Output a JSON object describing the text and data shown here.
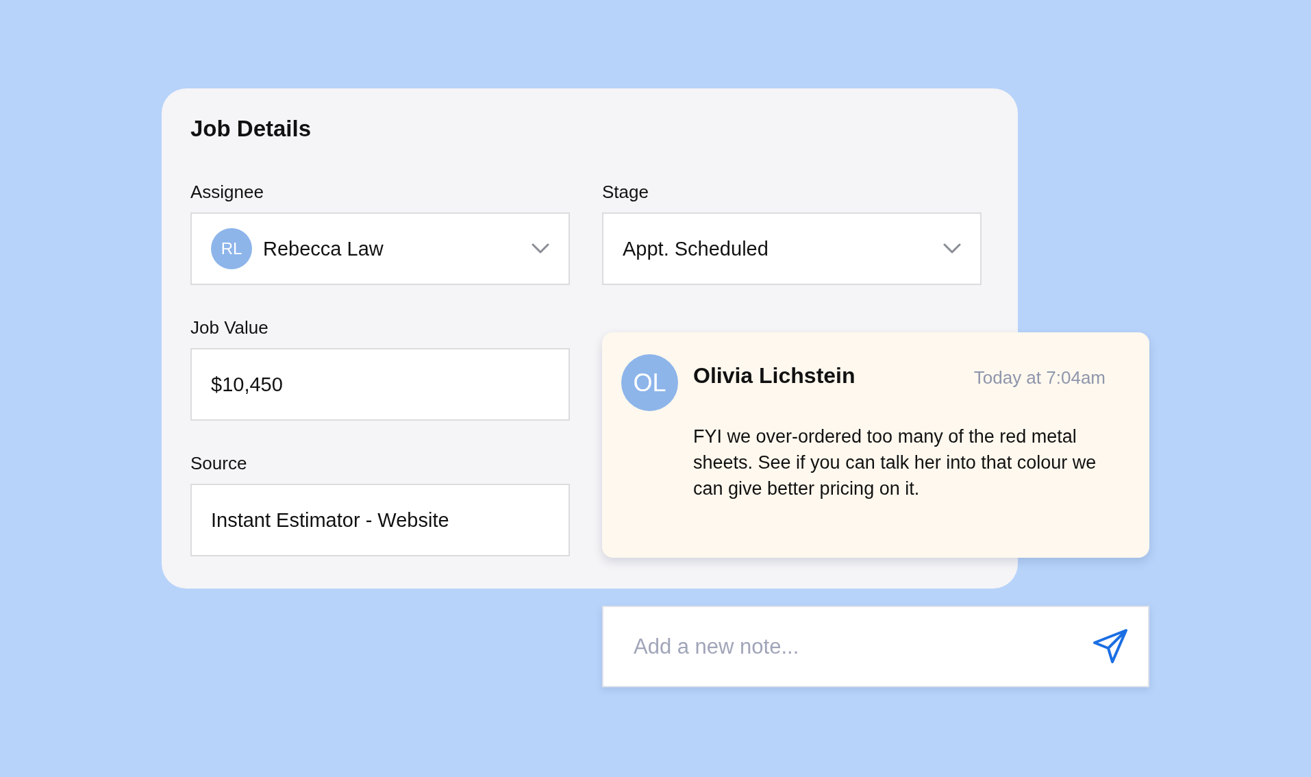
{
  "card": {
    "title": "Job Details"
  },
  "fields": [
    {
      "kind": "select",
      "label": "Assignee",
      "avatar": "RL",
      "value": "Rebecca Law"
    },
    {
      "kind": "select",
      "label": "Stage",
      "value": "Appt. Scheduled"
    },
    {
      "kind": "text",
      "label": "Job Value",
      "value": "$10,450"
    },
    {
      "kind": "text",
      "label": "Source",
      "value": "Instant Estimator - Website"
    }
  ],
  "note": {
    "avatar": "OL",
    "author": "Olivia Lichstein",
    "time": "Today at 7:04am",
    "body": "FYI we over-ordered too many of the red metal sheets. See if you can talk her into that colour we can give better pricing on it."
  },
  "new_note": {
    "placeholder": "Add a new note..."
  }
}
